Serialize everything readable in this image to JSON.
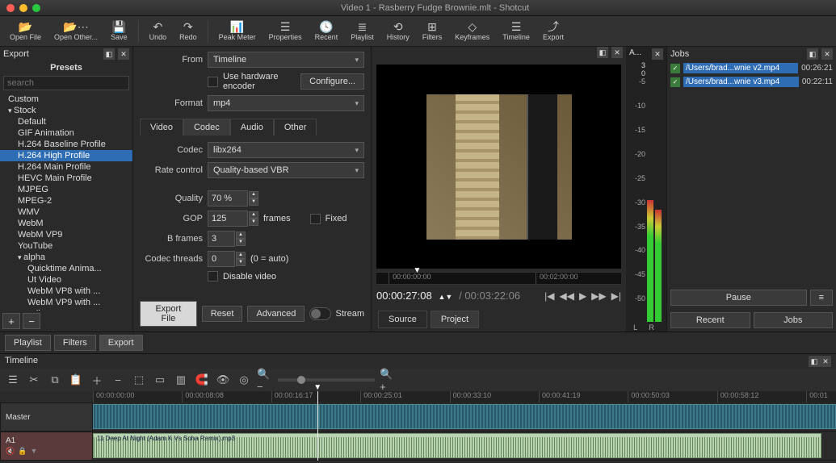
{
  "window": {
    "title": "Video 1 - Rasberry Fudge Brownie.mlt - Shotcut"
  },
  "toolbar": [
    {
      "icon": "📂",
      "label": "Open File",
      "sep": false
    },
    {
      "icon": "📂⋯",
      "label": "Open Other...",
      "sep": false
    },
    {
      "icon": "💾",
      "label": "Save",
      "sep": true
    },
    {
      "icon": "↶",
      "label": "Undo",
      "sep": false
    },
    {
      "icon": "↷",
      "label": "Redo",
      "sep": true
    },
    {
      "icon": "📊",
      "label": "Peak Meter",
      "sep": false
    },
    {
      "icon": "☰",
      "label": "Properties",
      "sep": false
    },
    {
      "icon": "🕓",
      "label": "Recent",
      "sep": false
    },
    {
      "icon": "≣",
      "label": "Playlist",
      "sep": false
    },
    {
      "icon": "⟲",
      "label": "History",
      "sep": false
    },
    {
      "icon": "⊞",
      "label": "Filters",
      "sep": false
    },
    {
      "icon": "◇",
      "label": "Keyframes",
      "sep": false
    },
    {
      "icon": "☰",
      "label": "Timeline",
      "sep": false
    },
    {
      "icon": "⤴",
      "label": "Export",
      "sep": false
    }
  ],
  "export": {
    "title": "Export",
    "presets_label": "Presets",
    "search_placeholder": "search",
    "tree": [
      {
        "lvl": 1,
        "label": "Custom",
        "caret": false
      },
      {
        "lvl": 1,
        "label": "Stock",
        "caret": true,
        "open": true
      },
      {
        "lvl": 2,
        "label": "Default"
      },
      {
        "lvl": 2,
        "label": "GIF Animation"
      },
      {
        "lvl": 2,
        "label": "H.264 Baseline Profile"
      },
      {
        "lvl": 2,
        "label": "H.264 High Profile",
        "selected": true
      },
      {
        "lvl": 2,
        "label": "H.264 Main Profile"
      },
      {
        "lvl": 2,
        "label": "HEVC Main Profile"
      },
      {
        "lvl": 2,
        "label": "MJPEG"
      },
      {
        "lvl": 2,
        "label": "MPEG-2"
      },
      {
        "lvl": 2,
        "label": "WMV"
      },
      {
        "lvl": 2,
        "label": "WebM"
      },
      {
        "lvl": 2,
        "label": "WebM VP9"
      },
      {
        "lvl": 2,
        "label": "YouTube"
      },
      {
        "lvl": 2,
        "label": "alpha",
        "caret": true,
        "open": true
      },
      {
        "lvl": 3,
        "label": "Quicktime Anima..."
      },
      {
        "lvl": 3,
        "label": "Ut Video"
      },
      {
        "lvl": 3,
        "label": "WebM VP8 with ..."
      },
      {
        "lvl": 3,
        "label": "WebM VP9 with ..."
      },
      {
        "lvl": 2,
        "label": "audio",
        "caret": true,
        "open": false
      }
    ],
    "from_label": "From",
    "from_value": "Timeline",
    "hw_label": "Use hardware encoder",
    "configure": "Configure...",
    "format_label": "Format",
    "format_value": "mp4",
    "tabs": [
      "Video",
      "Codec",
      "Audio",
      "Other"
    ],
    "active_tab": "Codec",
    "codec_label": "Codec",
    "codec_value": "libx264",
    "rate_label": "Rate control",
    "rate_value": "Quality-based VBR",
    "quality_label": "Quality",
    "quality_value": "70 %",
    "gop_label": "GOP",
    "gop_value": "125",
    "gop_unit": "frames",
    "fixed_label": "Fixed",
    "bframes_label": "B frames",
    "bframes_value": "3",
    "threads_label": "Codec threads",
    "threads_value": "0",
    "threads_hint": "(0 = auto)",
    "disable_label": "Disable video",
    "export_file": "Export File",
    "reset": "Reset",
    "advanced": "Advanced",
    "stream": "Stream"
  },
  "bottom_tabs": {
    "playlist": "Playlist",
    "filters": "Filters",
    "export": "Export",
    "active": "Export"
  },
  "preview": {
    "ticks": [
      {
        "pos": "5%",
        "label": "00:00:00:00"
      },
      {
        "pos": "65%",
        "label": "00:02:00:00"
      }
    ],
    "timecode": "00:00:27:08",
    "duration": "/ 00:03:22:06",
    "source": "Source",
    "project": "Project"
  },
  "meters": {
    "title": "A...",
    "top": "3",
    "zero": "0",
    "scale": [
      "-5",
      "-10",
      "-15",
      "-20",
      "-25",
      "-30",
      "-35",
      "-40",
      "-45",
      "-50"
    ]
  },
  "jobs": {
    "title": "Jobs",
    "items": [
      {
        "path": "/Users/brad...wnie v2.mp4",
        "dur": "00:26:21"
      },
      {
        "path": "/Users/brad...wnie v3.mp4",
        "dur": "00:22:11"
      }
    ],
    "pause": "Pause",
    "menu": "≡",
    "recent": "Recent",
    "jobs_btn": "Jobs"
  },
  "timeline": {
    "title": "Timeline",
    "master": "Master",
    "a1": "A1",
    "ruler": [
      "00:00:00:00",
      "00:00:08:08",
      "00:00:16:17",
      "00:00:25:01",
      "00:00:33:10",
      "00:00:41:19",
      "00:00:50:03",
      "00:00:58:12",
      "00:01"
    ],
    "audio_clip": "11 Deep At Night  (Adam K Vs Soha Remix).mp3"
  }
}
